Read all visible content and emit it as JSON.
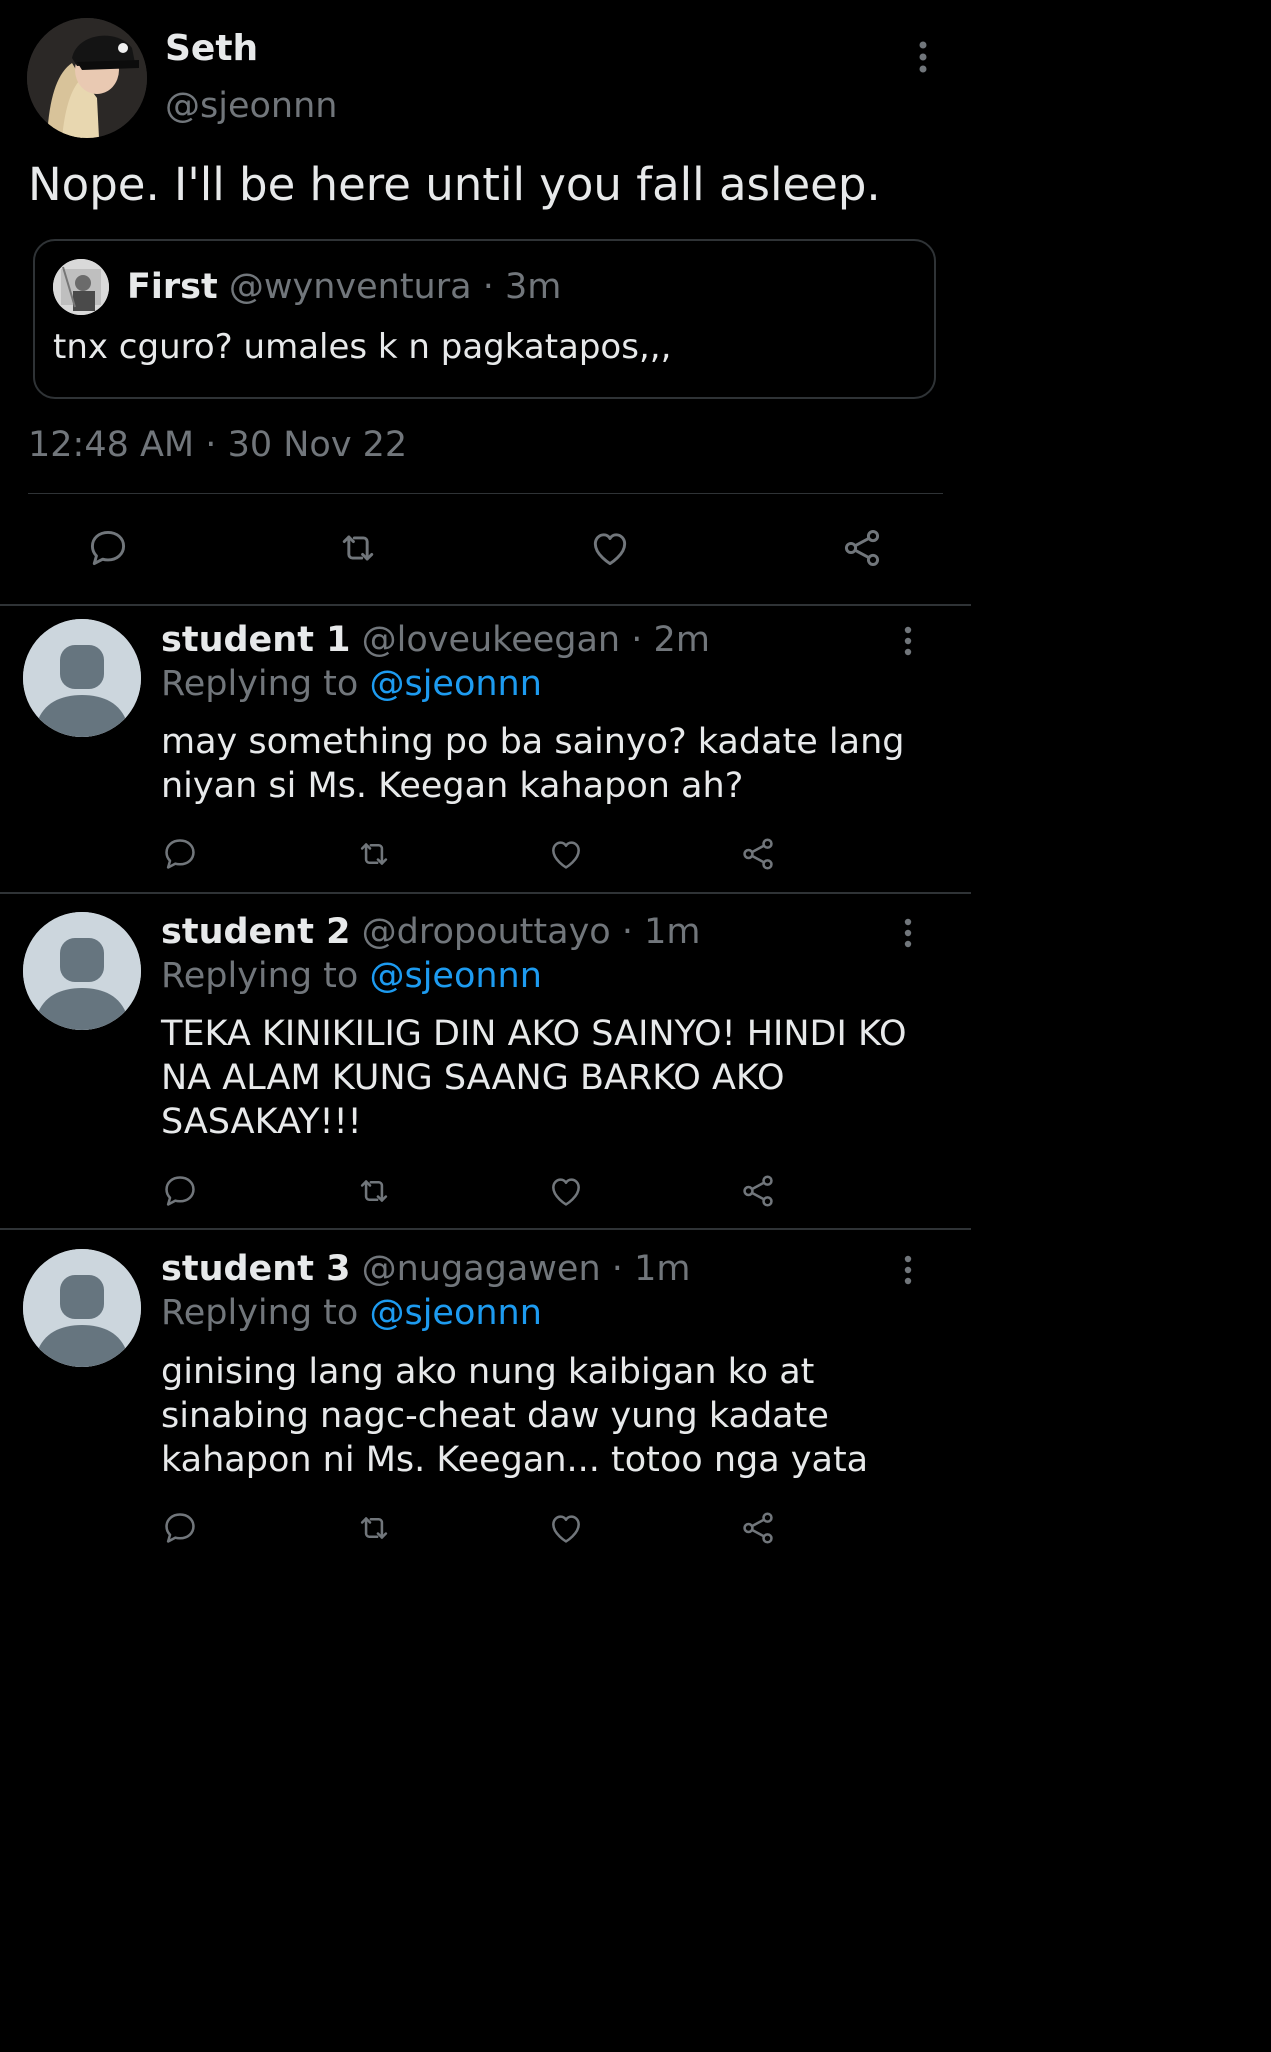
{
  "main_tweet": {
    "name": "Seth",
    "handle": "@sjeonnn",
    "text": "Nope. I'll be here until you fall asleep.",
    "quote": {
      "name": "First",
      "handle": "@wynventura",
      "separator": "·",
      "time": "3m",
      "text": "tnx cguro? umales k n pagkatapos,,,"
    },
    "timestamp": "12:48 AM",
    "date_separator": "·",
    "date": "30 Nov 22",
    "actions": [
      "reply-icon",
      "retweet-icon",
      "like-icon",
      "share-icon"
    ]
  },
  "replies": [
    {
      "name": "student 1",
      "handle": "@loveukeegan",
      "separator": "·",
      "time": "2m",
      "replying_label": "Replying to",
      "replying_handle": "@sjeonnn",
      "text": "may something po ba sainyo? kadate lang\nniyan si Ms. Keegan kahapon ah?"
    },
    {
      "name": "student 2",
      "handle": "@dropouttayo",
      "separator": "·",
      "time": "1m",
      "replying_label": "Replying to",
      "replying_handle": "@sjeonnn",
      "text": "TEKA KINIKILIG DIN AKO SAINYO! HINDI KO\nNA ALAM KUNG SAANG BARKO AKO\nSASAKAY!!!"
    },
    {
      "name": "student 3",
      "handle": "@nugagawen",
      "separator": "·",
      "time": "1m",
      "replying_label": "Replying to",
      "replying_handle": "@sjeonnn",
      "text": "ginising lang ako nung kaibigan ko  at\nsinabing nagc-cheat daw yung kadate\nkahapon ni Ms. Keegan... totoo nga yata"
    }
  ],
  "colors": {
    "background": "#000000",
    "text": "#e7e9ea",
    "muted": "#71767b",
    "link": "#1d9bf0",
    "divider": "#2f3336",
    "default_avatar": "#ccd6dd"
  }
}
